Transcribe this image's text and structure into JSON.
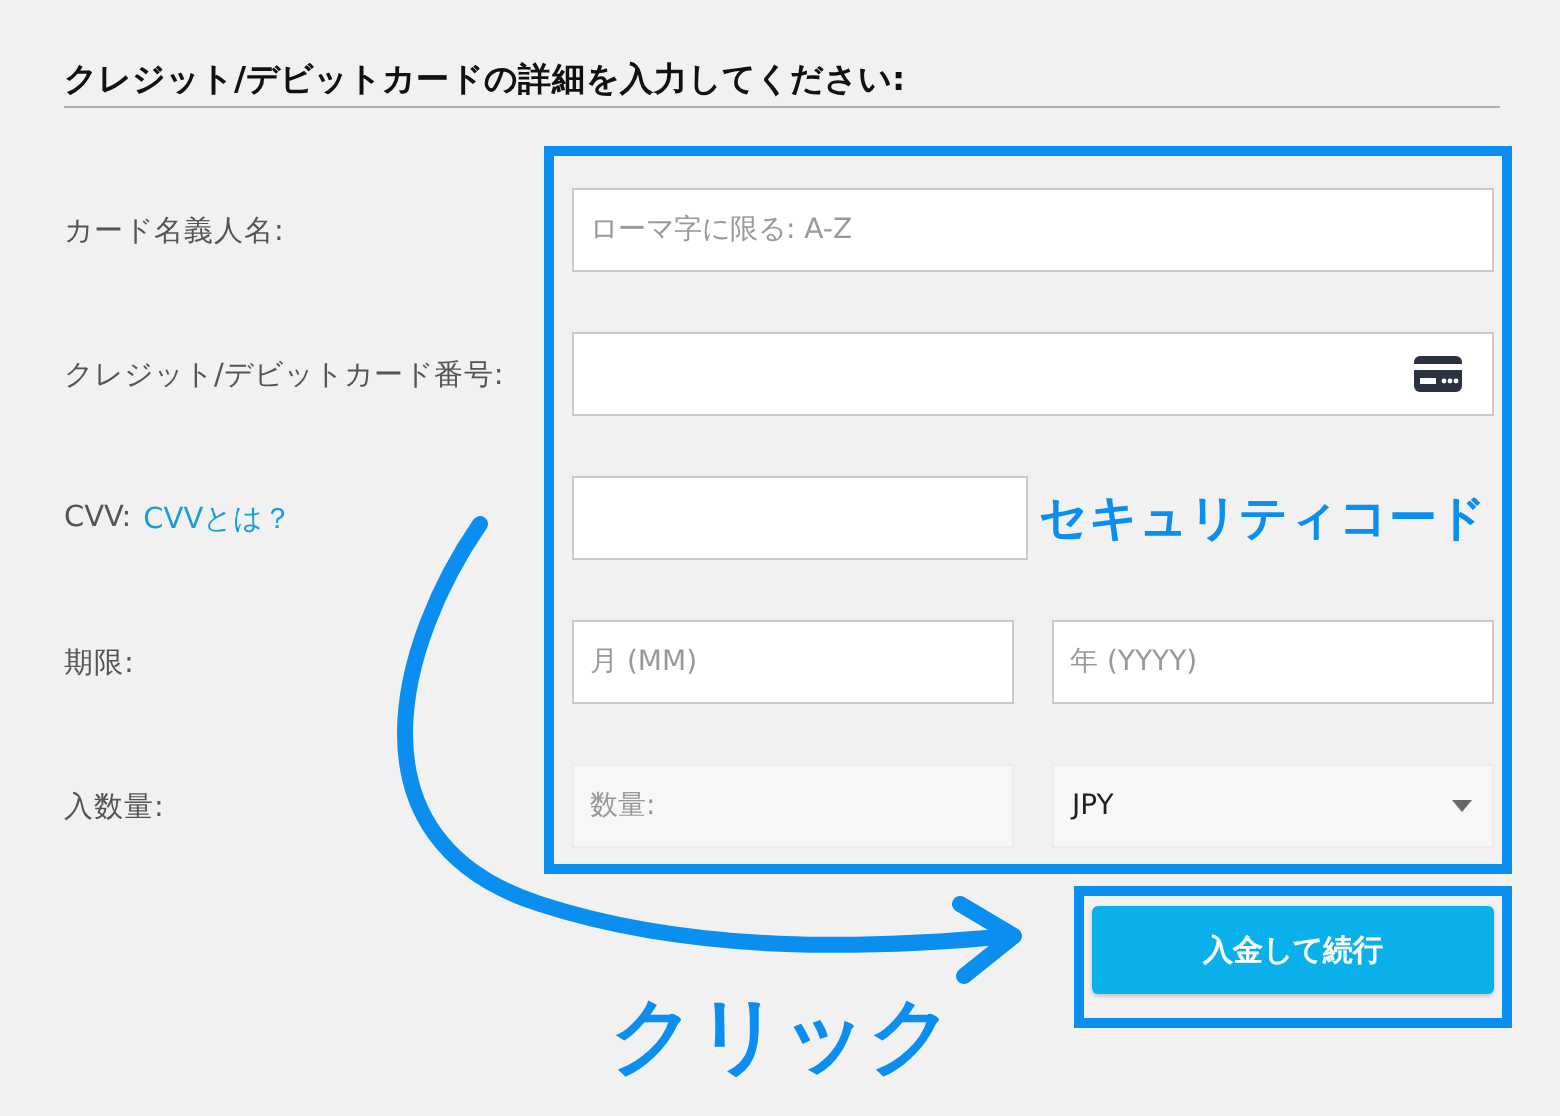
{
  "heading": "クレジット/デビットカードの詳細を入力してください:",
  "rows": [
    {
      "label": "カード名義人名:",
      "fields": [
        {
          "kind": "text",
          "placeholder": "ローマ字に限る: A-Z"
        }
      ]
    },
    {
      "label": "クレジット/デビットカード番号:",
      "fields": [
        {
          "kind": "card"
        }
      ]
    },
    {
      "label": "CVV:",
      "link": "CVVとは？",
      "fields": [
        {
          "kind": "short"
        }
      ],
      "note": "セキュリティコード"
    },
    {
      "label": "期限:",
      "fields": [
        {
          "kind": "text",
          "placeholder": "月 (MM)"
        },
        {
          "kind": "text",
          "placeholder": "年 (YYYY)"
        }
      ]
    },
    {
      "label": "入数量:",
      "fields": [
        {
          "kind": "amount",
          "placeholder": "数量:"
        },
        {
          "kind": "select",
          "value": "JPY"
        }
      ]
    }
  ],
  "button": "入金して続行",
  "annotation": "クリック"
}
